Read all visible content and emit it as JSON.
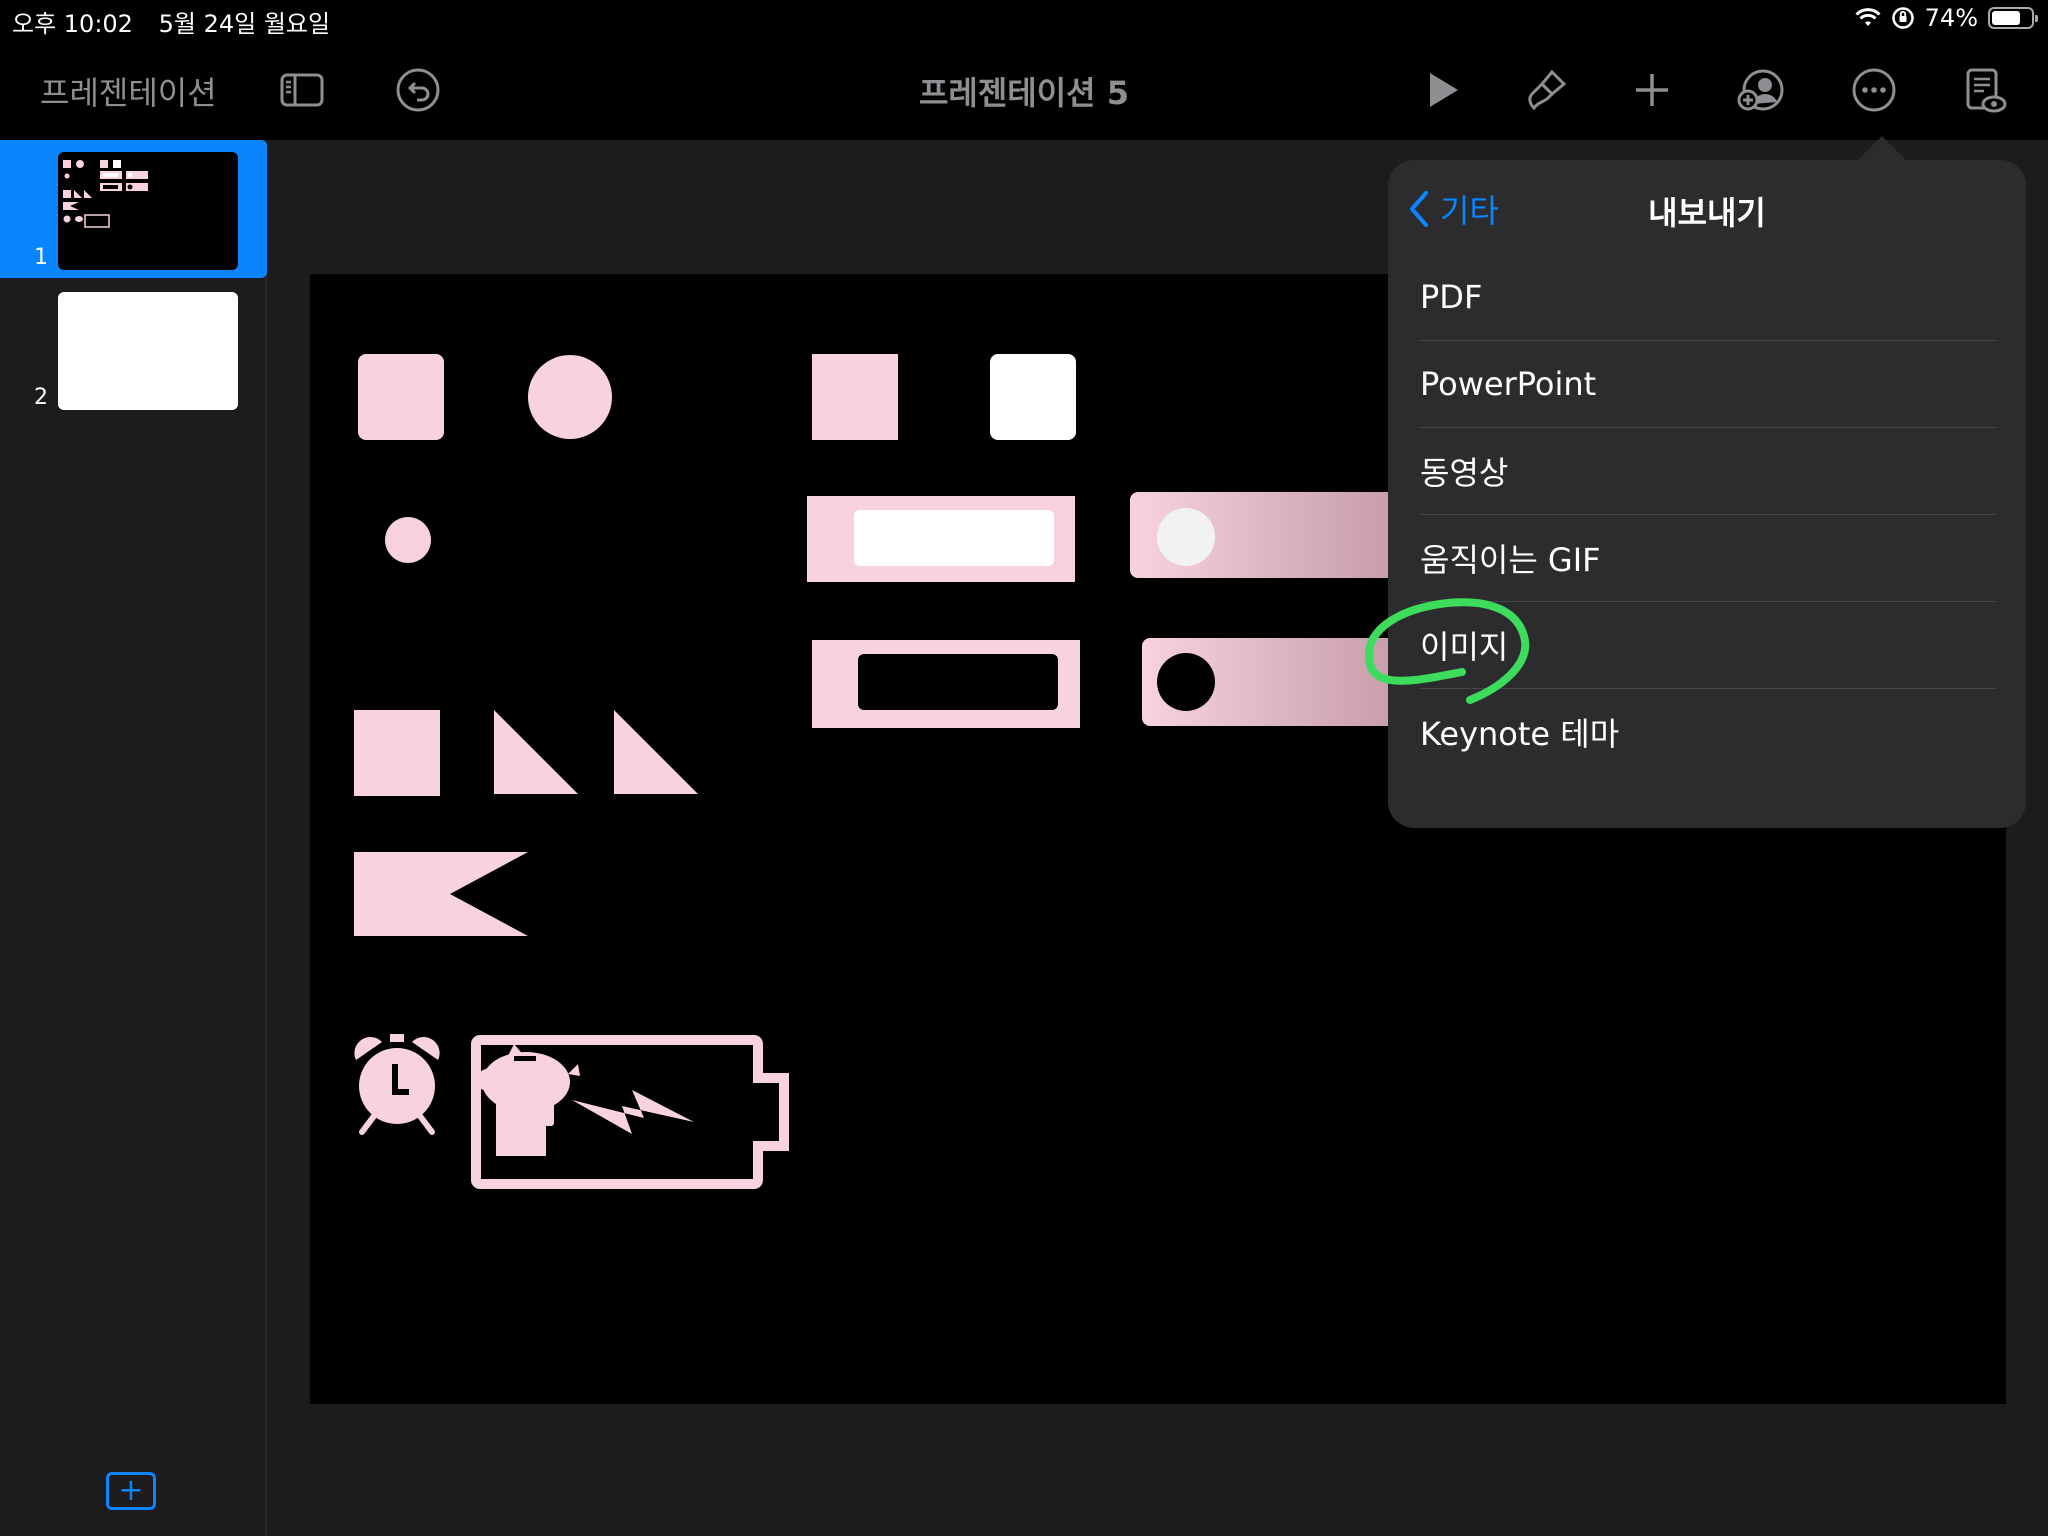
{
  "status_bar": {
    "time": "오후 10:02",
    "date": "5월 24일 월요일",
    "battery_text": "74%",
    "battery_level": 0.74
  },
  "toolbar": {
    "back_label": "프레젠테이션",
    "document_title": "프레젠테이션 5",
    "icons": [
      "sidebar-toggle-icon",
      "undo-icon",
      "play-icon",
      "paintbrush-icon",
      "add-icon",
      "collaborate-icon",
      "more-icon",
      "reader-view-icon"
    ]
  },
  "sidebar": {
    "slides": [
      {
        "number": "1",
        "selected": true,
        "theme": "dark"
      },
      {
        "number": "2",
        "selected": false,
        "theme": "light"
      }
    ],
    "add_slide_icon": "plus-icon"
  },
  "slide_canvas": {
    "background": "#000000",
    "shape_color": "#f8d3df",
    "shapes": [
      "rounded-square",
      "circle",
      "square",
      "white-rounded-square",
      "small-circle",
      "pink-bar-with-white-field",
      "pink-gradient-toggle-white-knob",
      "pink-bar-with-black-field",
      "pink-gradient-toggle-black-knob",
      "square",
      "right-triangle",
      "right-triangle",
      "flag-notch",
      "alarm-clock-icon",
      "piggy-bank-icon",
      "battery-charging-icon"
    ]
  },
  "popover": {
    "back_label": "기타",
    "title": "내보내기",
    "items": [
      "PDF",
      "PowerPoint",
      "동영상",
      "움직이는 GIF",
      "이미지",
      "Keynote 테마"
    ],
    "highlighted_item": "이미지",
    "annotation_color": "#3ddc5c"
  },
  "colors": {
    "accent": "#0a84ff",
    "toolbar_icon": "#8e8e93",
    "popover_bg": "#2c2c2e"
  }
}
